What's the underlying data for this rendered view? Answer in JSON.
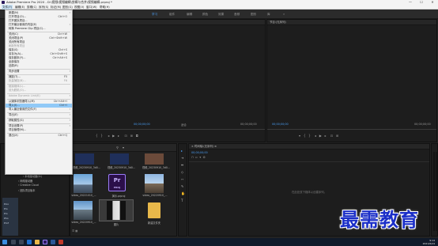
{
  "window": {
    "title": "Adobe Premiere Pro 2020 - D:\\视频\\视频编辑\\剪辑与合并\\视频编辑.prproj *",
    "controls": [
      "—",
      "☐",
      "✕"
    ]
  },
  "menubar": [
    "文件(F)",
    "编辑(E)",
    "剪辑(C)",
    "序列(S)",
    "标记(M)",
    "图形(G)",
    "视图(V)",
    "窗口(W)",
    "帮助(H)"
  ],
  "workspace_tabs": [
    {
      "label": "学习",
      "active": true
    },
    {
      "label": "组件",
      "active": false
    },
    {
      "label": "编辑",
      "active": false
    },
    {
      "label": "颜色",
      "active": false
    },
    {
      "label": "效果",
      "active": false
    },
    {
      "label": "音频",
      "active": false
    },
    {
      "label": "图形",
      "active": false
    },
    {
      "label": "库",
      "active": false
    },
    {
      "label": "»",
      "active": false
    }
  ],
  "source_monitor": {
    "timecode_left": "00;00;00;00",
    "timecode_right": "00;00;00;00",
    "zoom": "适合"
  },
  "program_monitor": {
    "title": "节目:(无序列)",
    "timecode_left": "00;00;00;00",
    "timecode_right": "00;00;00;00"
  },
  "timeline": {
    "title": "时间轴:(无序列)",
    "timecode": "00;00;00;00",
    "empty_hint": "在此处放下媒体以创建序列。"
  },
  "file_menu": {
    "items": [
      {
        "label": "新建(N)",
        "shortcut": "",
        "arrow": true,
        "disabled": false
      },
      {
        "label": "打开项目(O)...",
        "shortcut": "Ctrl+O",
        "arrow": false,
        "disabled": false
      },
      {
        "label": "打开团队项目...",
        "shortcut": "",
        "arrow": false,
        "disabled": false
      },
      {
        "label": "打开最近使用的内容(E)",
        "shortcut": "",
        "arrow": true,
        "disabled": false
      },
      {
        "label": "转换 Premiere Clip 项目(C)...",
        "shortcut": "",
        "arrow": false,
        "disabled": false
      },
      {
        "sep": true
      },
      {
        "label": "关闭(C)",
        "shortcut": "Ctrl+W",
        "arrow": false,
        "disabled": false
      },
      {
        "label": "关闭项目(P)",
        "shortcut": "Ctrl+Shift+W",
        "arrow": false,
        "disabled": false
      },
      {
        "label": "关闭所有项目",
        "shortcut": "",
        "arrow": false,
        "disabled": false
      },
      {
        "label": "刷新所有项目",
        "shortcut": "",
        "arrow": false,
        "disabled": true
      },
      {
        "label": "保存(S)",
        "shortcut": "Ctrl+S",
        "arrow": false,
        "disabled": false
      },
      {
        "label": "另存为(A)...",
        "shortcut": "Ctrl+Shift+S",
        "arrow": false,
        "disabled": false
      },
      {
        "label": "保存副本(Y)...",
        "shortcut": "Ctrl+Alt+S",
        "arrow": false,
        "disabled": false
      },
      {
        "label": "全部保存",
        "shortcut": "",
        "arrow": false,
        "disabled": false
      },
      {
        "label": "还原(R)",
        "shortcut": "",
        "arrow": false,
        "disabled": false
      },
      {
        "sep": true
      },
      {
        "label": "同步设置",
        "shortcut": "",
        "arrow": true,
        "disabled": false
      },
      {
        "sep": true
      },
      {
        "label": "捕捉(T)...",
        "shortcut": "F5",
        "arrow": false,
        "disabled": false
      },
      {
        "label": "批量捕捉(B)...",
        "shortcut": "F6",
        "arrow": false,
        "disabled": true
      },
      {
        "sep": true
      },
      {
        "label": "链接媒体(L)...",
        "shortcut": "",
        "arrow": false,
        "disabled": true
      },
      {
        "label": "设为脱机(O)...",
        "shortcut": "",
        "arrow": false,
        "disabled": true
      },
      {
        "sep": true
      },
      {
        "label": "Adobe Dynamic Link(K)",
        "shortcut": "",
        "arrow": true,
        "disabled": true
      },
      {
        "sep": true
      },
      {
        "label": "从媒体浏览器导入(M)",
        "shortcut": "Ctrl+Alt+I",
        "arrow": false,
        "disabled": false
      },
      {
        "label": "导入(I)...",
        "shortcut": "Ctrl+I",
        "arrow": false,
        "disabled": false,
        "highlight": true
      },
      {
        "label": "导入最近使用的文件(F)",
        "shortcut": "",
        "arrow": true,
        "disabled": false
      },
      {
        "sep": true
      },
      {
        "label": "导出(E)",
        "shortcut": "",
        "arrow": true,
        "disabled": false
      },
      {
        "sep": true
      },
      {
        "label": "获取属性(G)",
        "shortcut": "",
        "arrow": true,
        "disabled": false
      },
      {
        "sep": true
      },
      {
        "label": "项目设置(P)",
        "shortcut": "",
        "arrow": true,
        "disabled": false
      },
      {
        "label": "项目管理(M)...",
        "shortcut": "",
        "arrow": false,
        "disabled": false
      },
      {
        "sep": true
      },
      {
        "label": "退出(X)",
        "shortcut": "Ctrl+Q",
        "arrow": false,
        "disabled": false
      }
    ]
  },
  "media_browser": {
    "tree": [
      "本地驱动器(C:)",
      "本地驱动器(D:)",
      "网络驱动器",
      "Creative Cloud",
      "团队项目版本"
    ],
    "side_labels": [
      "Pico",
      "Pro",
      "Pro",
      "Pho",
      "Prof"
    ]
  },
  "project_bin": {
    "items": [
      {
        "caption": "视频_20230910_3d0...",
        "kind": "video"
      },
      {
        "caption": "视频_20230910_3d0...",
        "kind": "video"
      },
      {
        "caption": "视频_20230910_3d0...",
        "kind": "video"
      },
      {
        "caption": "video_20221010_...",
        "kind": "photo"
      },
      {
        "caption": "演示.prproj",
        "kind": "pr"
      },
      {
        "caption": "video_20220910_...",
        "kind": "photo"
      },
      {
        "caption": "video_20220910_...",
        "kind": "photo"
      },
      {
        "caption": "图片",
        "kind": "selected"
      },
      {
        "caption": "新建文件夹",
        "kind": "folder"
      }
    ]
  },
  "taskbar": {
    "time": "9:14",
    "date": "2021/6/24"
  },
  "watermark": "最需教育",
  "colors": {
    "accent": "#4a9ff5",
    "highlight": "#91c9f7"
  }
}
